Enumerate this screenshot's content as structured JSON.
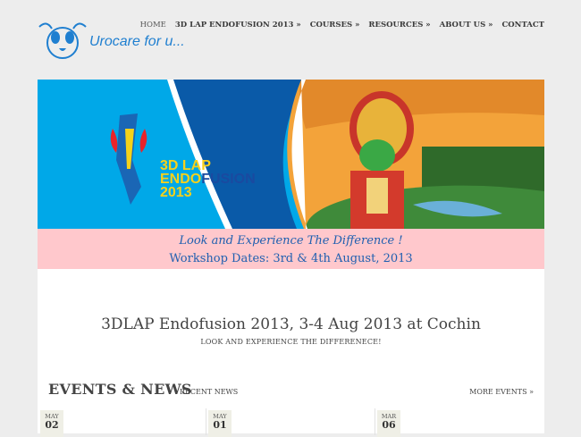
{
  "header": {
    "logo_text": "Urocare for u...",
    "nav": [
      {
        "label": "HOME"
      },
      {
        "label": "3D LAP ENDOFUSION 2013 »"
      },
      {
        "label": "COURSES »"
      },
      {
        "label": "RESOURCES »"
      },
      {
        "label": "ABOUT US »"
      },
      {
        "label": "CONTACT"
      }
    ]
  },
  "banner": {
    "event_logo": {
      "line1": "3D LAP",
      "line2_a": "ENDO",
      "line2_b": "FUSION",
      "line3": "2013"
    },
    "tagline": "Look and Experience The Difference !",
    "dates": "Workshop Dates: 3rd & 4th August, 2013"
  },
  "main": {
    "headline": "3DLAP Endofusion 2013, 3-4 Aug 2013 at Cochin",
    "subheadline": "LOOK AND EXPERIENCE THE DIFFERENECE!"
  },
  "events": {
    "title": "EVENTS & NEWS",
    "recent_label": "RECENT NEWS",
    "more_label": "MORE EVENTS »",
    "items": [
      {
        "month": "MAY",
        "day": "02"
      },
      {
        "month": "MAY",
        "day": "01"
      },
      {
        "month": "MAR",
        "day": "06"
      }
    ]
  },
  "colors": {
    "banner_blue": "#00a8e8",
    "banner_dark_blue": "#0a5aa8",
    "strip_pink": "#ffc8cc",
    "text_blue": "#1f5fb0",
    "logo_blue": "#1f7fd0"
  }
}
